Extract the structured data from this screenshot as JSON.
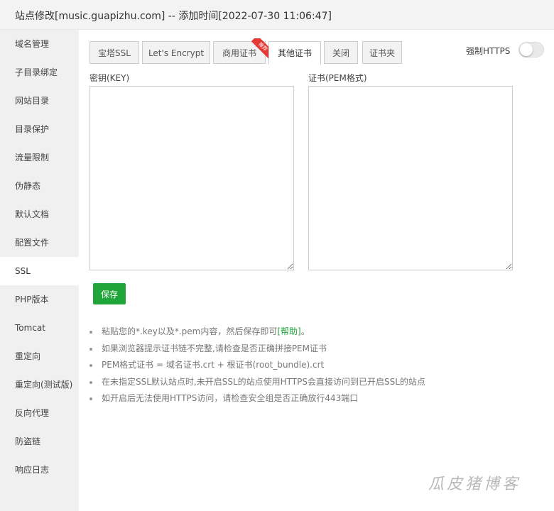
{
  "window": {
    "title": "站点修改[music.guapizhu.com] -- 添加时间[2022-07-30 11:06:47]"
  },
  "sidebar": {
    "items": [
      {
        "label": "域名管理"
      },
      {
        "label": "子目录绑定"
      },
      {
        "label": "网站目录"
      },
      {
        "label": "目录保护"
      },
      {
        "label": "流量限制"
      },
      {
        "label": "伪静态"
      },
      {
        "label": "默认文档"
      },
      {
        "label": "配置文件"
      },
      {
        "label": "SSL"
      },
      {
        "label": "PHP版本"
      },
      {
        "label": "Tomcat"
      },
      {
        "label": "重定向"
      },
      {
        "label": "重定向(测试版)"
      },
      {
        "label": "反向代理"
      },
      {
        "label": "防盗链"
      },
      {
        "label": "响应日志"
      }
    ],
    "active_index": 8
  },
  "tabs": {
    "items": [
      {
        "label": "宝塔SSL"
      },
      {
        "label": "Let's Encrypt"
      },
      {
        "label": "商用证书",
        "badge": "推荐"
      },
      {
        "label": "其他证书"
      },
      {
        "label": "关闭"
      },
      {
        "label": "证书夹"
      }
    ],
    "active_index": 3
  },
  "force_https": {
    "label": "强制HTTPS",
    "enabled": false
  },
  "key_field": {
    "label": "密钥(KEY)",
    "value": ""
  },
  "cert_field": {
    "label": "证书(PEM格式)",
    "value": ""
  },
  "save_label": "保存",
  "tips": {
    "tip1_prefix": "粘贴您的*.key以及*.pem内容，然后保存即可",
    "tip1_link": "[帮助]",
    "tip1_suffix": "。",
    "tip2": "如果浏览器提示证书链不完整,请检查是否正确拼接PEM证书",
    "tip3": "PEM格式证书 = 域名证书.crt + 根证书(root_bundle).crt",
    "tip4": "在未指定SSL默认站点时,未开启SSL的站点使用HTTPS会直接访问到已开启SSL的站点",
    "tip5": "如开启后无法使用HTTPS访问，请检查安全组是否正确放行443端口"
  },
  "watermark": "瓜皮猪博客",
  "colors": {
    "accent": "#20a53a",
    "badge": "#e53935"
  }
}
